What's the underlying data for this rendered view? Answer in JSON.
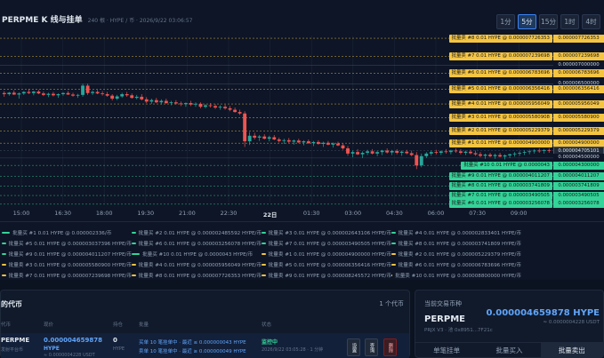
{
  "header": {
    "title": "PERPME K 线与挂单",
    "meta": "240 根 · HYPE / 币 · 2026/9/22 03:06:57"
  },
  "timeframes": [
    {
      "label": "1分",
      "active": false
    },
    {
      "label": "5分",
      "active": true
    },
    {
      "label": "15分",
      "active": false
    },
    {
      "label": "1时",
      "active": false
    },
    {
      "label": "4时",
      "active": false
    }
  ],
  "colors": {
    "up": "#26a69a",
    "down": "#ef5350",
    "sell": "#f5c542",
    "buy": "#34d399",
    "accent": "#3b82f6"
  },
  "chart_data": {
    "type": "candlestick",
    "x_ticks": [
      "15:00",
      "16:30",
      "18:00",
      "19:30",
      "21:00",
      "22:30",
      "22日",
      "01:30",
      "03:00",
      "04:30",
      "06:00",
      "07:30",
      "09:00"
    ],
    "ylim": [
      3.3e-06,
      7.8e-06
    ],
    "sell_orders": [
      {
        "label": "批量卖 #8 0.01 HYPE @ 0.000007726353",
        "price": "0.000007726353",
        "value": 7.726353e-06
      },
      {
        "label": "批量卖 #7 0.01 HYPE @ 0.000007239698",
        "price": "0.000007239698",
        "value": 7.239698e-06
      },
      {
        "label": "",
        "price": "0.000007000000",
        "value": 7e-06
      },
      {
        "label": "批量卖 #6 0.01 HYPE @ 0.000006783696",
        "price": "0.000006783696",
        "value": 6.783696e-06
      },
      {
        "label": "",
        "price": "0.000006500000",
        "value": 6.5e-06
      },
      {
        "label": "批量卖 #5 0.01 HYPE @ 0.000006356416",
        "price": "0.000006356416",
        "value": 6.356416e-06
      },
      {
        "label": "批量卖 #4 0.01 HYPE @ 0.000005956049",
        "price": "0.000005956049",
        "value": 5.956049e-06
      },
      {
        "label": "批量卖 #3 0.01 HYPE @ 0.000005580908",
        "price": "0.000005580900",
        "value": 5.5809e-06
      },
      {
        "label": "批量卖 #2 0.01 HYPE @ 0.000005229379",
        "price": "0.000005229379",
        "value": 5.229379e-06
      },
      {
        "label": "批量卖 #1 0.01 HYPE @ 0.000004900000",
        "price": "0.000004900000",
        "value": 4.9e-06
      }
    ],
    "current_price": {
      "price": "0.000004705101",
      "value": 4.705101e-06
    },
    "neutral_price": {
      "price": "0.000004500000",
      "value": 4.5e-06
    },
    "buy_orders": [
      {
        "label": "批量买 #10 0.01 HYPE @ 0.0000043",
        "price": "0.000004300000",
        "value": 4.3e-06
      },
      {
        "label": "批量买 #9 0.01 HYPE @ 0.000004011207",
        "price": "0.000004011207",
        "value": 4.011207e-06
      },
      {
        "label": "批量买 #8 0.01 HYPE @ 0.000003741809",
        "price": "0.000003741809",
        "value": 3.741809e-06
      },
      {
        "label": "批量买 #7 0.01 HYPE @ 0.000003490505",
        "price": "0.000003490505",
        "value": 3.490505e-06
      },
      {
        "label": "批量买 #6 0.01 HYPE @ 0.000003256078",
        "price": "0.000003256078",
        "value": 3.256078e-06
      }
    ],
    "candles": [
      [
        6.25,
        6.3,
        6.15,
        6.22
      ],
      [
        6.22,
        6.28,
        6.18,
        6.26
      ],
      [
        6.26,
        6.32,
        6.2,
        6.21
      ],
      [
        6.21,
        6.27,
        6.1,
        6.24
      ],
      [
        6.24,
        6.3,
        6.2,
        6.28
      ],
      [
        6.28,
        6.36,
        6.22,
        6.25
      ],
      [
        6.25,
        6.31,
        6.19,
        6.29
      ],
      [
        6.29,
        6.33,
        6.22,
        6.24
      ],
      [
        6.24,
        6.29,
        6.17,
        6.2
      ],
      [
        6.2,
        6.26,
        6.14,
        6.23
      ],
      [
        6.23,
        6.28,
        6.16,
        6.19
      ],
      [
        6.19,
        6.24,
        6.12,
        6.22
      ],
      [
        6.22,
        6.27,
        6.18,
        6.25
      ],
      [
        6.25,
        6.3,
        6.2,
        6.21
      ],
      [
        6.21,
        6.26,
        6.15,
        6.18
      ],
      [
        6.18,
        6.23,
        6.12,
        6.2
      ],
      [
        6.2,
        6.5,
        6.15,
        6.45
      ],
      [
        6.45,
        6.5,
        6.2,
        6.25
      ],
      [
        6.25,
        6.32,
        6.2,
        6.28
      ],
      [
        6.28,
        6.33,
        6.22,
        6.24
      ],
      [
        6.24,
        6.3,
        6.18,
        6.22
      ],
      [
        6.22,
        6.28,
        6.15,
        6.18
      ],
      [
        6.18,
        6.22,
        6.05,
        6.1
      ],
      [
        6.1,
        6.2,
        6.06,
        6.16
      ],
      [
        6.16,
        6.26,
        6.12,
        6.22
      ],
      [
        6.22,
        6.28,
        6.15,
        6.19
      ],
      [
        6.19,
        6.24,
        6.1,
        6.12
      ],
      [
        6.12,
        6.2,
        6.08,
        6.15
      ],
      [
        6.15,
        6.22,
        6.05,
        6.08
      ],
      [
        6.08,
        6.14,
        5.98,
        6.02
      ],
      [
        6.02,
        6.1,
        5.96,
        6.06
      ],
      [
        6.06,
        6.12,
        5.98,
        6.0
      ],
      [
        6.0,
        6.08,
        5.94,
        6.04
      ],
      [
        6.04,
        6.1,
        5.96,
        5.98
      ],
      [
        5.98,
        6.04,
        5.92,
        6.0
      ],
      [
        6.0,
        6.06,
        5.94,
        5.97
      ],
      [
        5.97,
        6.02,
        5.9,
        5.95
      ],
      [
        5.95,
        6.0,
        5.88,
        5.98
      ],
      [
        5.98,
        6.04,
        5.9,
        5.94
      ],
      [
        5.94,
        6.0,
        5.88,
        5.96
      ],
      [
        5.96,
        6.0,
        5.84,
        5.88
      ],
      [
        5.88,
        5.95,
        5.84,
        5.92
      ],
      [
        5.92,
        5.98,
        5.86,
        5.9
      ],
      [
        5.9,
        5.95,
        5.82,
        5.86
      ],
      [
        5.86,
        5.92,
        5.8,
        5.88
      ],
      [
        5.88,
        5.94,
        5.8,
        5.84
      ],
      [
        5.84,
        5.9,
        5.76,
        5.8
      ],
      [
        5.8,
        5.86,
        5.72,
        5.74
      ],
      [
        5.74,
        5.8,
        5.66,
        5.7
      ],
      [
        5.7,
        5.76,
        4.8,
        4.95
      ],
      [
        4.95,
        5.2,
        4.85,
        5.1
      ],
      [
        5.1,
        5.18,
        5.0,
        5.05
      ],
      [
        5.05,
        5.12,
        4.96,
        5.08
      ],
      [
        5.08,
        5.14,
        5.0,
        5.02
      ],
      [
        5.02,
        5.1,
        4.95,
        5.06
      ],
      [
        5.06,
        5.12,
        4.98,
        5.0
      ],
      [
        5.0,
        5.05,
        4.92,
        4.96
      ],
      [
        4.96,
        5.02,
        4.88,
        4.98
      ],
      [
        4.98,
        5.04,
        4.9,
        4.94
      ],
      [
        4.94,
        5.0,
        4.86,
        4.97
      ],
      [
        4.97,
        5.02,
        4.9,
        4.92
      ],
      [
        4.92,
        4.98,
        4.84,
        4.95
      ],
      [
        4.95,
        5.0,
        4.88,
        4.9
      ],
      [
        4.9,
        4.96,
        4.82,
        4.93
      ],
      [
        4.93,
        4.98,
        4.86,
        4.88
      ],
      [
        4.88,
        4.94,
        4.8,
        4.91
      ],
      [
        4.91,
        4.96,
        4.84,
        4.86
      ],
      [
        4.86,
        4.92,
        4.78,
        4.89
      ],
      [
        4.89,
        4.94,
        4.82,
        4.84
      ],
      [
        4.84,
        4.9,
        4.72,
        4.76
      ],
      [
        4.76,
        4.82,
        4.56,
        4.62
      ],
      [
        4.62,
        4.7,
        4.52,
        4.66
      ],
      [
        4.66,
        4.74,
        4.58,
        4.6
      ],
      [
        4.6,
        4.68,
        4.5,
        4.64
      ],
      [
        4.64,
        4.72,
        4.58,
        4.68
      ],
      [
        4.68,
        4.74,
        4.6,
        4.62
      ],
      [
        4.62,
        4.7,
        4.55,
        4.66
      ],
      [
        4.66,
        4.72,
        4.58,
        4.7
      ],
      [
        4.7,
        4.76,
        4.62,
        4.65
      ],
      [
        4.65,
        4.72,
        4.58,
        4.69
      ],
      [
        4.69,
        4.74,
        4.6,
        4.64
      ],
      [
        4.64,
        4.7,
        4.56,
        4.67
      ],
      [
        4.67,
        4.72,
        4.6,
        4.63
      ],
      [
        4.63,
        4.7,
        4.55,
        4.58
      ],
      [
        4.58,
        4.66,
        4.2,
        4.3
      ],
      [
        4.3,
        4.62,
        4.25,
        4.55
      ],
      [
        4.55,
        4.66,
        4.5,
        4.62
      ],
      [
        4.62,
        4.7,
        4.56,
        4.66
      ],
      [
        4.66,
        4.72,
        4.6,
        4.64
      ],
      [
        4.64,
        4.7,
        4.58,
        4.68
      ],
      [
        4.68,
        4.74,
        4.62,
        4.66
      ],
      [
        4.66,
        4.72,
        4.6,
        4.7
      ],
      [
        4.7,
        4.76,
        4.64,
        4.68
      ],
      [
        4.68,
        4.74,
        4.6,
        4.64
      ],
      [
        4.64,
        4.7,
        4.58,
        4.67
      ],
      [
        4.67,
        4.72,
        4.6,
        4.63
      ],
      [
        4.63,
        4.7,
        4.56,
        4.6
      ],
      [
        4.6,
        4.66,
        4.52,
        4.56
      ],
      [
        4.56,
        4.62,
        4.48,
        4.59
      ],
      [
        4.59,
        4.64,
        4.52,
        4.55
      ],
      [
        4.55,
        4.62,
        4.48,
        4.58
      ],
      [
        4.58,
        4.64,
        4.52,
        4.54
      ],
      [
        4.54,
        4.6,
        4.46,
        4.57
      ],
      [
        4.57,
        4.62,
        4.5,
        4.6
      ],
      [
        4.6,
        4.66,
        4.54,
        4.62
      ],
      [
        4.62,
        4.68,
        4.56,
        4.64
      ],
      [
        4.64,
        4.7,
        4.58,
        4.66
      ],
      [
        4.66,
        4.72,
        4.6,
        4.68
      ],
      [
        4.68,
        4.74,
        4.62,
        4.7
      ],
      [
        4.7,
        4.76,
        4.64,
        4.69
      ],
      [
        4.69,
        4.74,
        4.62,
        4.71
      ],
      [
        4.71,
        4.76,
        4.64,
        4.7
      ]
    ]
  },
  "legend": [
    {
      "side": "buy",
      "label": "批量买 #1 0.01 HYPE @ 0.000002336/币"
    },
    {
      "side": "buy",
      "label": "批量买 #2 0.01 HYPE @ 0.000002485592 HYPE/币"
    },
    {
      "side": "buy",
      "label": "批量买 #3 0.01 HYPE @ 0.000002643106 HYPE/币"
    },
    {
      "side": "buy",
      "label": "批量买 #4 0.01 HYPE @ 0.000002833401 HYPE/币"
    },
    {
      "side": "buy",
      "label": "批量买 #5 0.01 HYPE @ 0.000003037396 HYPE/币"
    },
    {
      "side": "buy",
      "label": "批量买 #6 0.01 HYPE @ 0.000003256078 HYPE/币"
    },
    {
      "side": "buy",
      "label": "批量买 #7 0.01 HYPE @ 0.000003490505 HYPE/币"
    },
    {
      "side": "buy",
      "label": "批量买 #8 0.01 HYPE @ 0.000003741809 HYPE/币"
    },
    {
      "side": "buy",
      "label": "批量买 #9 0.01 HYPE @ 0.000004011207 HYPE/币"
    },
    {
      "side": "buy",
      "label": "批量买 #10 0.01 HYPE @ 0.0000043 HYPE/币"
    },
    {
      "side": "sell",
      "label": "批量卖 #1 0.01 HYPE @ 0.000004900000 HYPE/币"
    },
    {
      "side": "sell",
      "label": "批量卖 #2 0.01 HYPE @ 0.000005229379 HYPE/币"
    },
    {
      "side": "sell",
      "label": "批量卖 #3 0.01 HYPE @ 0.000005580900 HYPE/币"
    },
    {
      "side": "sell",
      "label": "批量卖 #4 0.01 HYPE @ 0.000005956049 HYPE/币"
    },
    {
      "side": "sell",
      "label": "批量卖 #5 0.01 HYPE @ 0.000006356416 HYPE/币"
    },
    {
      "side": "sell",
      "label": "批量卖 #6 0.01 HYPE @ 0.000006783696 HYPE/币"
    },
    {
      "side": "sell",
      "label": "批量卖 #7 0.01 HYPE @ 0.000007239698 HYPE/币"
    },
    {
      "side": "sell",
      "label": "批量卖 #8 0.01 HYPE @ 0.000007726353 HYPE/币"
    },
    {
      "side": "sell",
      "label": "批量卖 #9 0.01 HYPE @ 0.000008245572 HYPE/币"
    },
    {
      "side": "sell",
      "label": "批量卖 #10 0.01 HYPE @ 0.000008800000 HYPE/币"
    }
  ],
  "table": {
    "title": "的代币",
    "count": "1 个代币",
    "headers": {
      "coin": "代币",
      "price": "现价",
      "hold": "持仓",
      "orders": "批量",
      "status": "状态"
    },
    "row": {
      "coin": "PERPME",
      "coin_sub": "发射平台币",
      "price": "0.000004659878",
      "price_unit": "HYPE",
      "price_usdt": "≈ 0.0000004228 USDT",
      "hold": "0",
      "hold_unit": "HYPE",
      "orders_buy": "买单 10 笔挂单中 · 最近 ≤ 0.000000043 HYPE",
      "orders_sell": "卖单 10 笔挂单中 · 最近 ≥ 0.000000049 HYPE",
      "status": "监控中",
      "status_time": "2026/9/22 03:05:28 · 1 分钟",
      "btn_settings": "设置",
      "btn_query": "查询",
      "btn_delete": "删除"
    }
  },
  "right_panel": {
    "label": "当前交易币种",
    "coin": "PERPME",
    "sub": "PRJX V3 · 池 0x8951...7F21c",
    "price": "0.000004659878 HYPE",
    "usdt": "≈ 0.0000004228 USDT",
    "tabs": [
      {
        "label": "单笔挂单",
        "active": false
      },
      {
        "label": "批量买入",
        "active": false
      },
      {
        "label": "批量卖出",
        "active": true
      }
    ]
  }
}
